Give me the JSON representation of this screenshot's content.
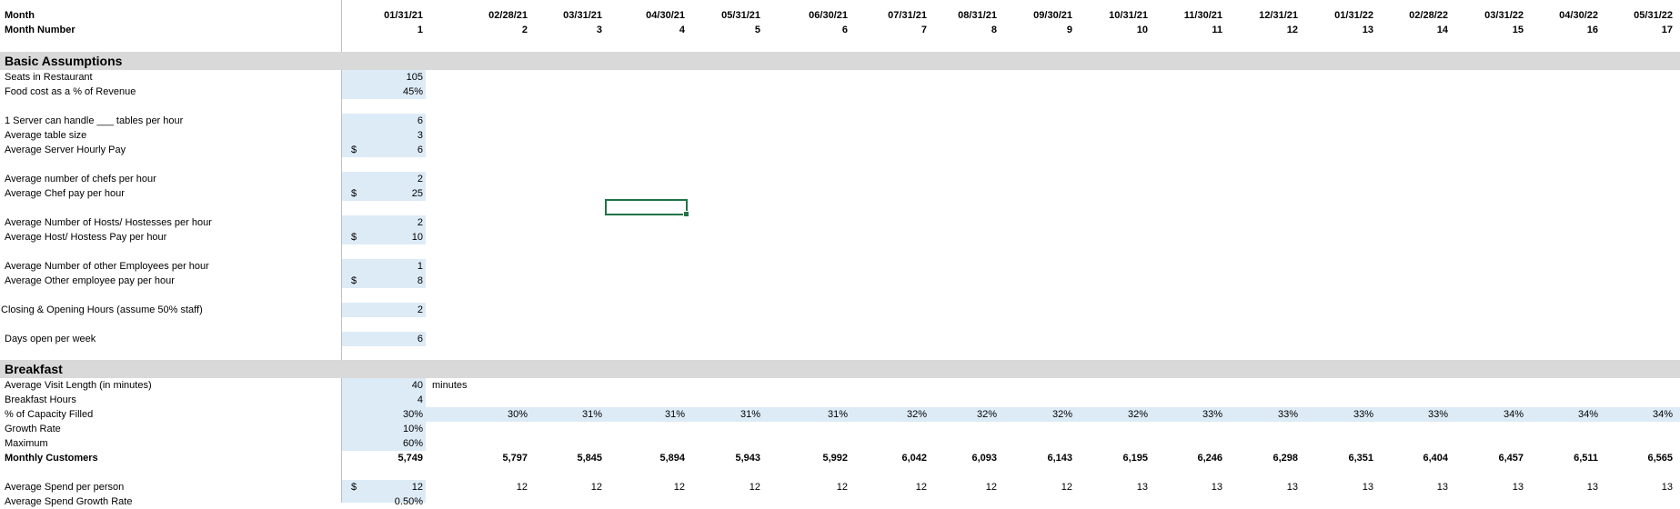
{
  "header": {
    "month_label": "Month",
    "month_number_label": "Month Number",
    "months": [
      "01/31/21",
      "02/28/21",
      "03/31/21",
      "04/30/21",
      "05/31/21",
      "06/30/21",
      "07/31/21",
      "08/31/21",
      "09/30/21",
      "10/31/21",
      "11/30/21",
      "12/31/21",
      "01/31/22",
      "02/28/22",
      "03/31/22",
      "04/30/22",
      "05/31/22"
    ],
    "numbers": [
      "1",
      "2",
      "3",
      "4",
      "5",
      "6",
      "7",
      "8",
      "9",
      "10",
      "11",
      "12",
      "13",
      "14",
      "15",
      "16",
      "17"
    ]
  },
  "basic": {
    "title": "Basic Assumptions",
    "seats_label": "Seats in Restaurant",
    "seats_value": "105",
    "food_label": "Food cost as a % of Revenue",
    "food_value": "45%",
    "server_tables_label": "1 Server can handle ___ tables per hour",
    "server_tables_value": "6",
    "table_size_label": "Average table size",
    "table_size_value": "3",
    "server_pay_label": "Average Server Hourly Pay",
    "server_pay_value": "6",
    "chefs_label": "Average number of chefs per hour",
    "chefs_value": "2",
    "chef_pay_label": "Average Chef pay per hour",
    "chef_pay_value": "25",
    "hosts_label": "Average Number of Hosts/ Hostesses per hour",
    "hosts_value": "2",
    "host_pay_label": "Average Host/ Hostess Pay per hour",
    "host_pay_value": "10",
    "other_label": "Average Number of other Employees per hour",
    "other_value": "1",
    "other_pay_label": "Average Other employee pay per hour",
    "other_pay_value": "8",
    "closing_label": "Closing & Opening Hours (assume 50% staff)",
    "closing_value": "2",
    "days_label": "Days open per week",
    "days_value": "6",
    "currency": "$"
  },
  "breakfast": {
    "title": "Breakfast",
    "visit_label": "Average Visit Length (in minutes)",
    "visit_value": "40",
    "visit_unit": "minutes",
    "hours_label": "Breakfast Hours",
    "hours_value": "4",
    "capacity_label": "% of Capacity Filled",
    "capacity_values": [
      "30%",
      "30%",
      "31%",
      "31%",
      "31%",
      "31%",
      "32%",
      "32%",
      "32%",
      "32%",
      "33%",
      "33%",
      "33%",
      "33%",
      "34%",
      "34%",
      "34%"
    ],
    "growth_label": "Growth Rate",
    "growth_value": "10%",
    "max_label": "Maximum",
    "max_value": "60%",
    "customers_label": "Monthly Customers",
    "customers_values": [
      "5,749",
      "5,797",
      "5,845",
      "5,894",
      "5,943",
      "5,992",
      "6,042",
      "6,093",
      "6,143",
      "6,195",
      "6,246",
      "6,298",
      "6,351",
      "6,404",
      "6,457",
      "6,511",
      "6,565"
    ],
    "spend_label": "Average Spend per person",
    "spend_values": [
      "12",
      "12",
      "12",
      "12",
      "12",
      "12",
      "12",
      "12",
      "12",
      "13",
      "13",
      "13",
      "13",
      "13",
      "13",
      "13",
      "13"
    ],
    "spend_growth_label": "Average Spend Growth Rate",
    "spend_growth_value": "0.50%",
    "currency": "$"
  },
  "colors": {
    "input_fill": "#ddebf7",
    "band_fill": "#d9d9d9",
    "selection": "#217346"
  }
}
